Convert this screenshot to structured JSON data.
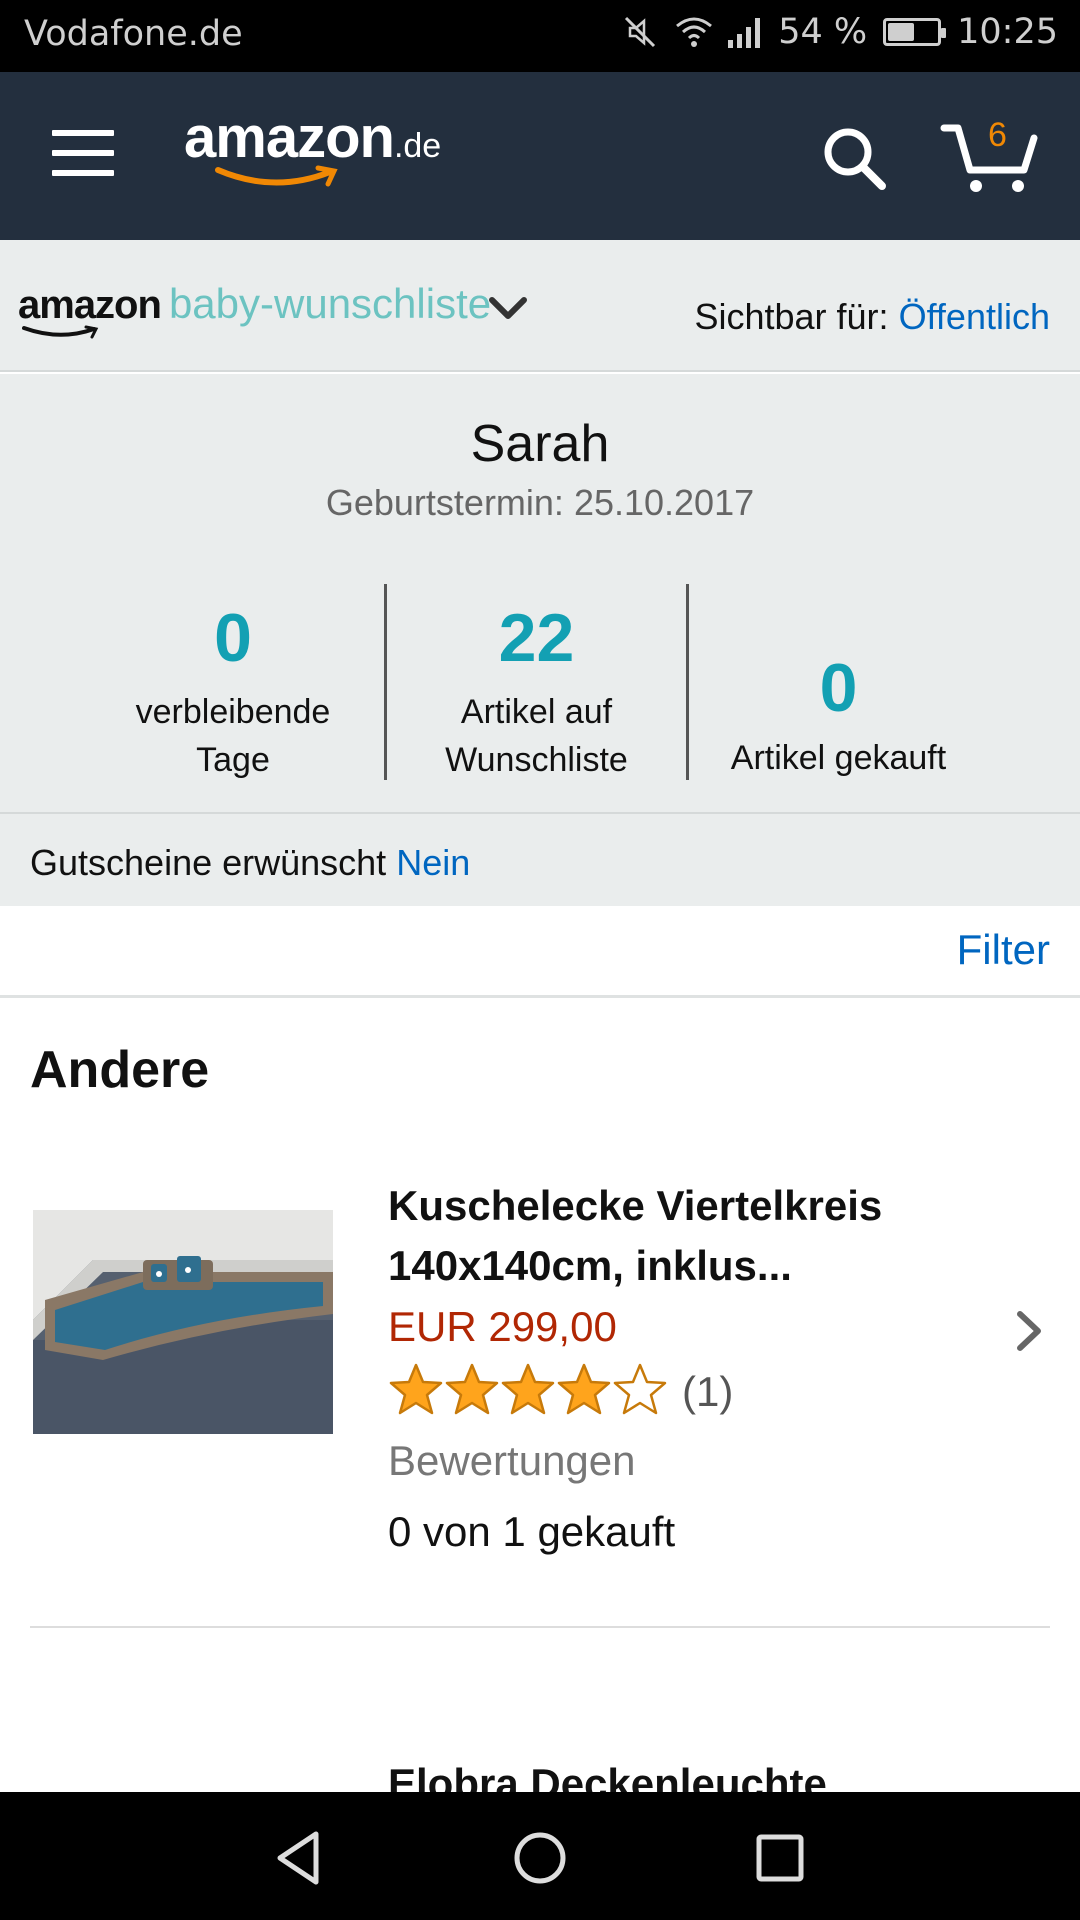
{
  "status_bar": {
    "carrier": "Vodafone.de",
    "battery": "54 %",
    "battery_level": 0.54,
    "time": "10:25",
    "icons": [
      "mute-icon",
      "wifi-icon",
      "signal-icon",
      "battery-icon"
    ]
  },
  "header": {
    "logo_word": "amazon",
    "logo_tld": ".de",
    "cart_count": "6",
    "icons": [
      "menu-icon",
      "search-icon",
      "cart-icon"
    ],
    "accent_color": "#f08804",
    "background": "#232f3e"
  },
  "wishlist_header": {
    "logo_word": "amazon",
    "logo_product": "baby-wunschliste",
    "visibility_label": "Sichtbar für:",
    "visibility_value": "Öffentlich"
  },
  "profile": {
    "name": "Sarah",
    "due_date": "Geburtstermin: 25.10.2017",
    "stats": [
      {
        "value": "0",
        "label_line1": "verbleibende",
        "label_line2": "Tage"
      },
      {
        "value": "22",
        "label_line1": "Artikel auf",
        "label_line2": "Wunschliste"
      },
      {
        "value": "0",
        "label_line1": "",
        "label_line2": "Artikel gekauft"
      }
    ],
    "stat_color": "#13a0b3"
  },
  "vouchers": {
    "label": "Gutscheine erwünscht",
    "value": "Nein"
  },
  "filter_label": "Filter",
  "section_title": "Andere",
  "products": [
    {
      "title_line1": "Kuschelecke Viertelkreis",
      "title_line2": "140x140cm, inklus...",
      "price": "EUR 299,00",
      "rating": 4,
      "rating_max": 5,
      "rating_count": "(1)",
      "rating_label": "Bewertungen",
      "bought": "0 von 1 gekauft"
    }
  ],
  "next_product_title": "Elobra Deckenleuchte",
  "nav_bar": {
    "icons": [
      "back-icon",
      "home-icon",
      "recents-icon"
    ]
  }
}
